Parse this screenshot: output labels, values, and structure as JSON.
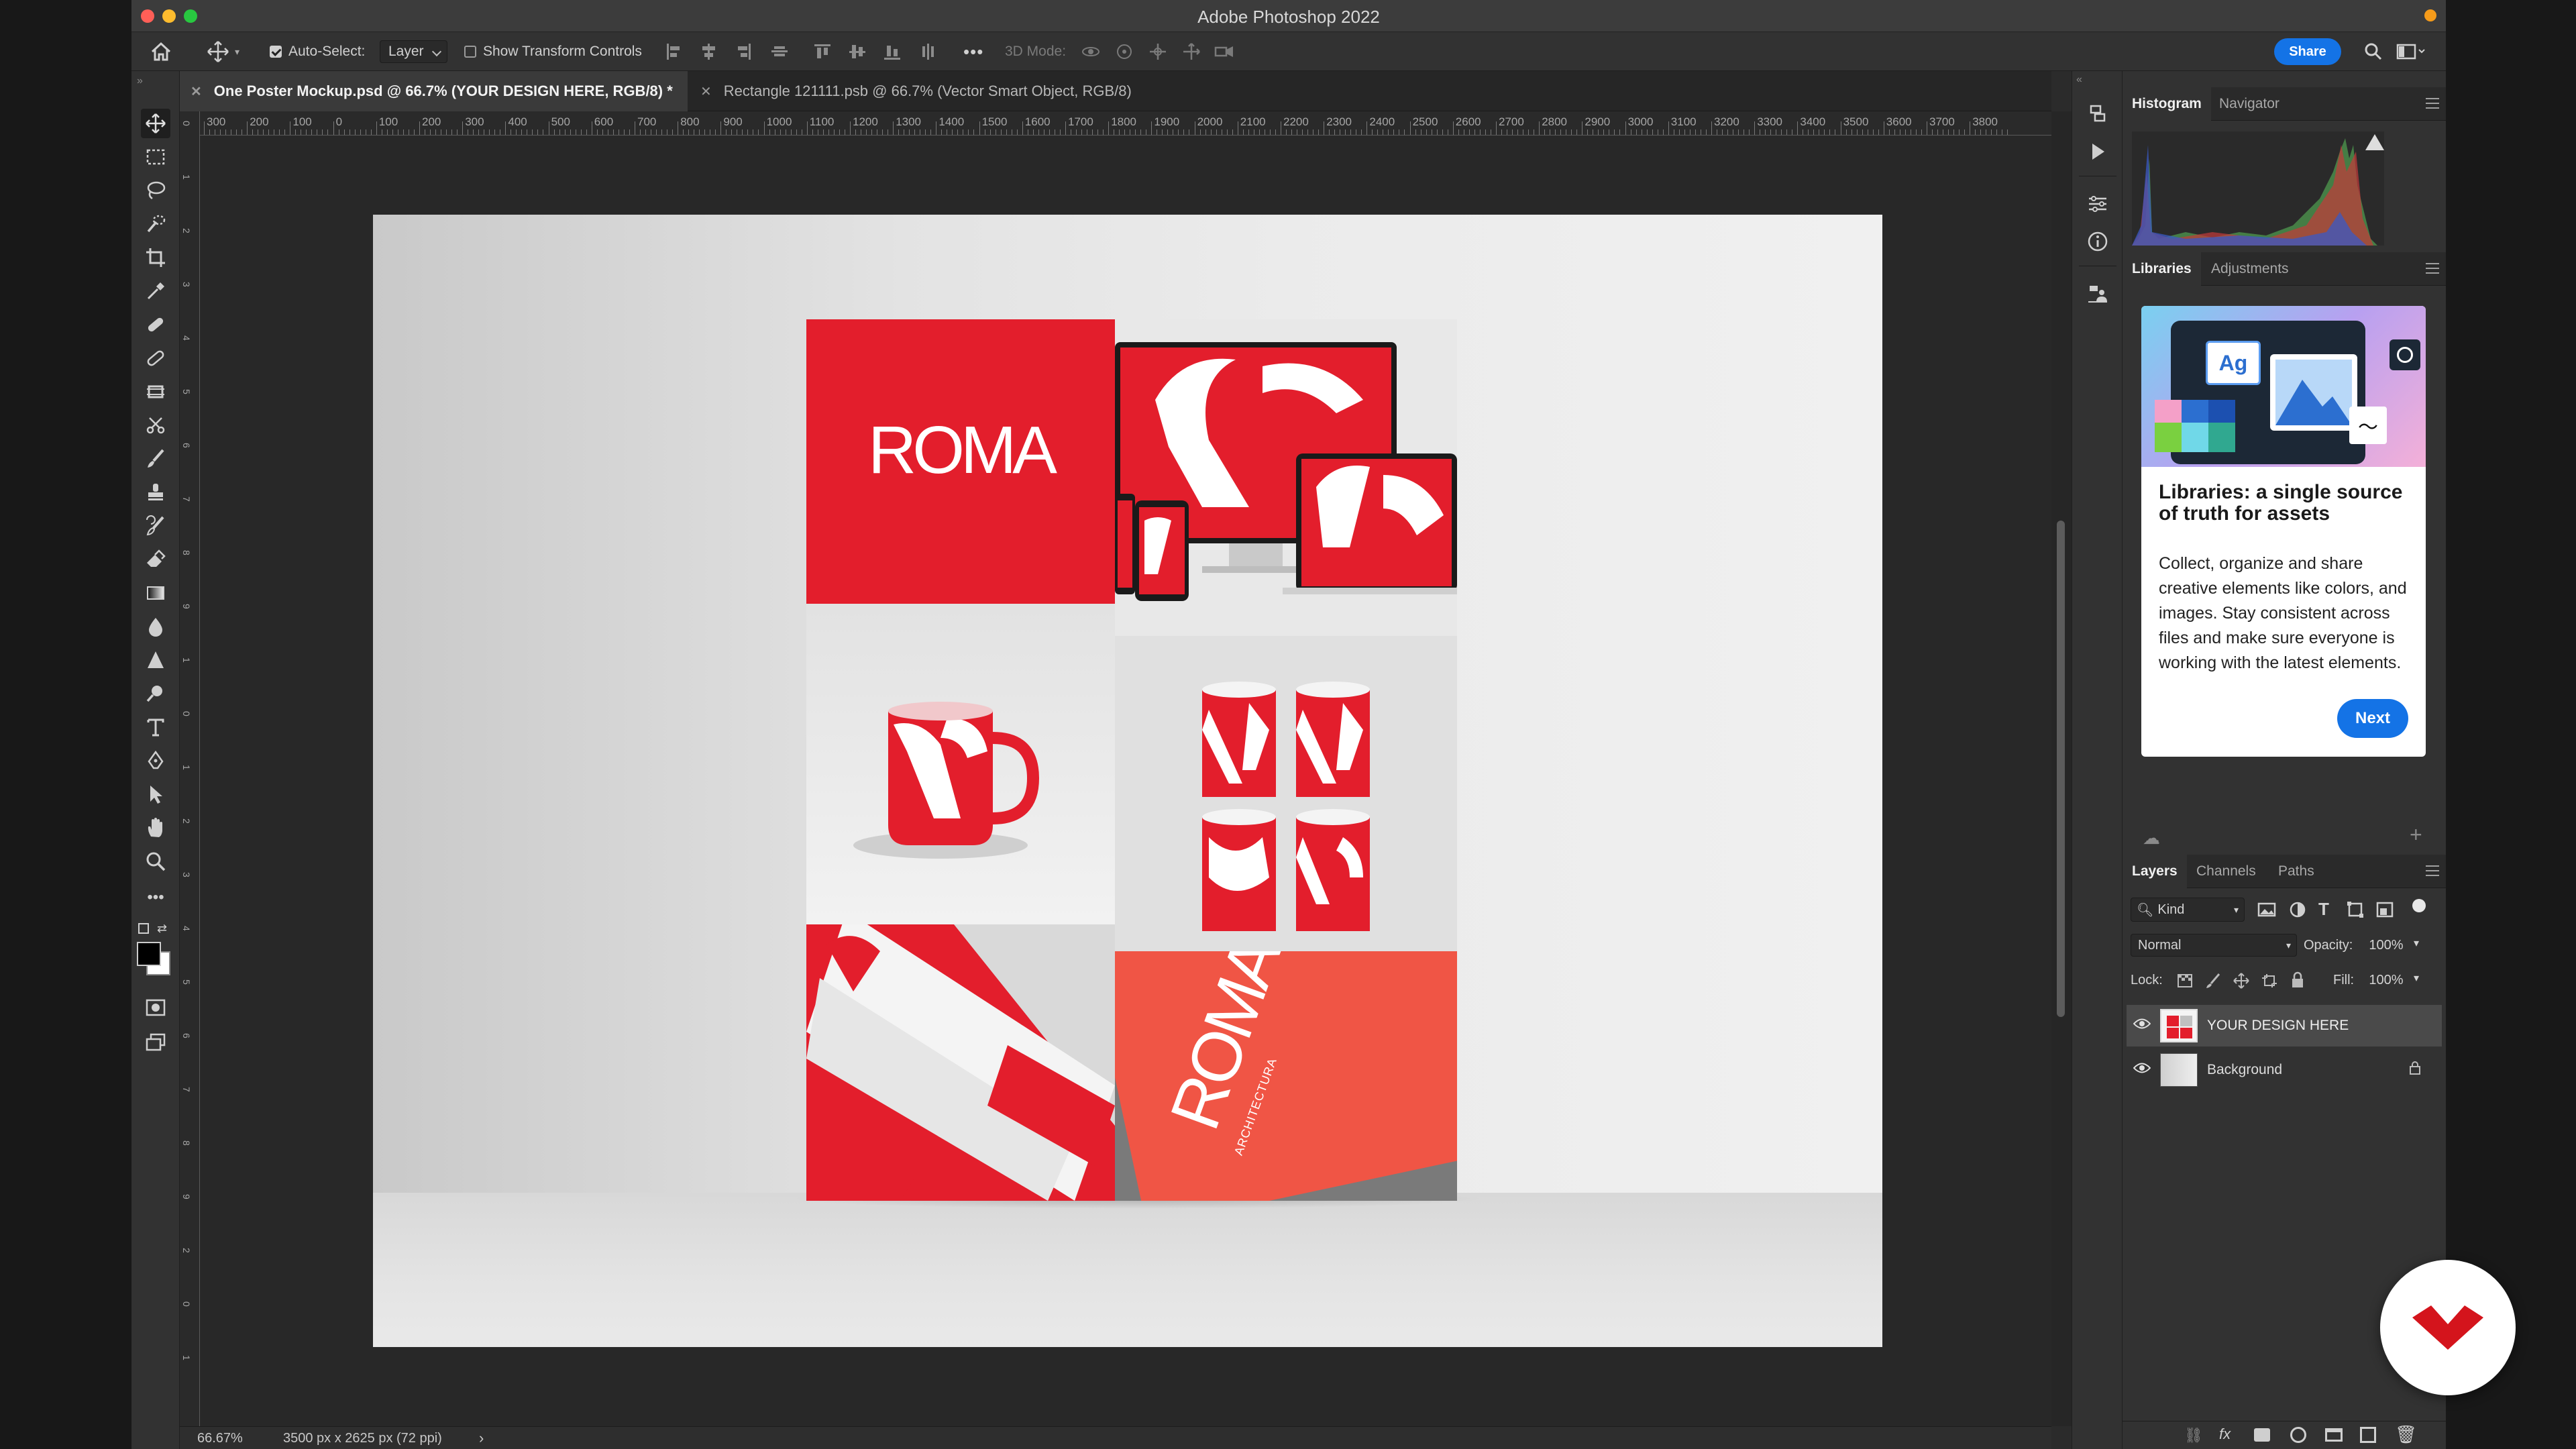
{
  "window": {
    "title": "Adobe Photoshop 2022"
  },
  "options_bar": {
    "auto_select_label": "Auto-Select:",
    "auto_select_value": "Layer",
    "show_transform_label": "Show Transform Controls",
    "mode_3d_label": "3D Mode:",
    "share_label": "Share"
  },
  "tabs": [
    {
      "label": "One Poster Mockup.psd @ 66.7% (YOUR DESIGN HERE, RGB/8) *",
      "active": true
    },
    {
      "label": "Rectangle 121111.psb @ 66.7% (Vector Smart Object, RGB/8)",
      "active": false
    }
  ],
  "ruler": {
    "top_labels": [
      "300",
      "200",
      "100",
      "0",
      "100",
      "200",
      "300",
      "400",
      "500",
      "600",
      "700",
      "800",
      "900",
      "1000",
      "1100",
      "1200",
      "1300",
      "1400",
      "1500",
      "1600",
      "1700",
      "1800",
      "1900",
      "2000",
      "2100",
      "2200",
      "2300",
      "2400",
      "2500",
      "2600",
      "2700",
      "2800",
      "2900",
      "3000",
      "3100",
      "3200",
      "3300",
      "3400",
      "3500",
      "3600",
      "3700",
      "3800"
    ],
    "left_labels": [
      "0",
      "1",
      "2",
      "3",
      "4",
      "5",
      "6",
      "7",
      "8",
      "9",
      "1",
      "0",
      "1",
      "2",
      "3",
      "4",
      "5",
      "6",
      "7",
      "8",
      "9",
      "2",
      "0",
      "1"
    ]
  },
  "document": {
    "brand_text": "ROMA",
    "sub_text": "ARCHITECTURA"
  },
  "status": {
    "zoom": "66.67%",
    "doc_size": "3500 px x 2625 px (72 ppi)",
    "arrow": "›"
  },
  "panels": {
    "top_tabs": [
      "Histogram",
      "Navigator"
    ],
    "mid_tabs": [
      "Libraries",
      "Adjustments"
    ],
    "library_card": {
      "heading": "Libraries: a single source of truth for assets",
      "body": "Collect, organize and share creative elements like colors, and images. Stay consistent across files and make sure everyone is working with the latest elements.",
      "next_label": "Next",
      "ag_label": "Ag"
    },
    "layers_tabs": [
      "Layers",
      "Channels",
      "Paths"
    ],
    "kind_label": "Kind",
    "blend_mode": "Normal",
    "opacity_label": "Opacity:",
    "opacity_value": "100%",
    "lock_label": "Lock:",
    "fill_label": "Fill:",
    "fill_value": "100%",
    "layers": [
      {
        "name": "YOUR DESIGN HERE",
        "selected": true,
        "locked": false
      },
      {
        "name": "Background",
        "selected": false,
        "locked": true
      }
    ]
  },
  "colors": {
    "brand_red": "#e31e2c",
    "accent_blue": "#1473e6",
    "ui_bg": "#323232"
  }
}
